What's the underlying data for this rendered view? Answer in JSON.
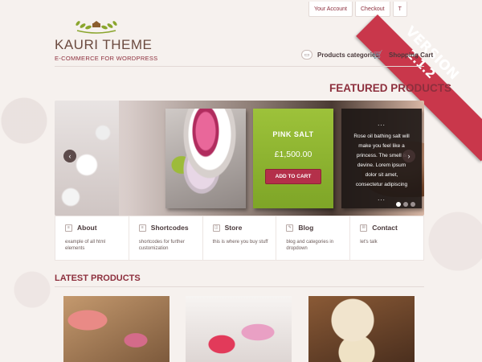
{
  "brand": {
    "name": "KAURI THEME",
    "tagline": "E-COMMERCE FOR WORDPRESS"
  },
  "top_links": [
    "Your Account",
    "Checkout",
    "T"
  ],
  "version_ribbon": {
    "line1": "VERSION",
    "line2": "2.1.2",
    "color": "#c9374b"
  },
  "nav": {
    "categories": "Products categories",
    "cart": "Shopping Cart"
  },
  "featured": {
    "title": "FEATURED PRODUCTS",
    "product_name": "PINK SALT",
    "price": "£1,500.00",
    "add_to_cart": "ADD TO CART",
    "description": "Rose oil bathing salt will make you feel like a princess. The smell is devine. Lorem ipsum dolor sit amet, consectetur adipiscing",
    "ellipsis_top": "...",
    "ellipsis_bottom": "...",
    "slide_count": 3,
    "active_slide": 1
  },
  "features": [
    {
      "title": "About",
      "text": "example of all html elements",
      "icon": "document-icon"
    },
    {
      "title": "Shortcodes",
      "text": "shortcodes for further customization",
      "icon": "code-icon"
    },
    {
      "title": "Store",
      "text": "this is where you buy stuff",
      "icon": "bag-icon"
    },
    {
      "title": "Blog",
      "text": "blog and categories in dropdown",
      "icon": "pencil-icon"
    },
    {
      "title": "Contact",
      "text": "let's talk",
      "icon": "mail-icon"
    }
  ],
  "latest": {
    "title": "LATEST PRODUCTS"
  },
  "colors": {
    "accent": "#8d2f3d",
    "green_card": "#9dc23a",
    "button": "#b4304a",
    "background": "#f6f1ee"
  }
}
